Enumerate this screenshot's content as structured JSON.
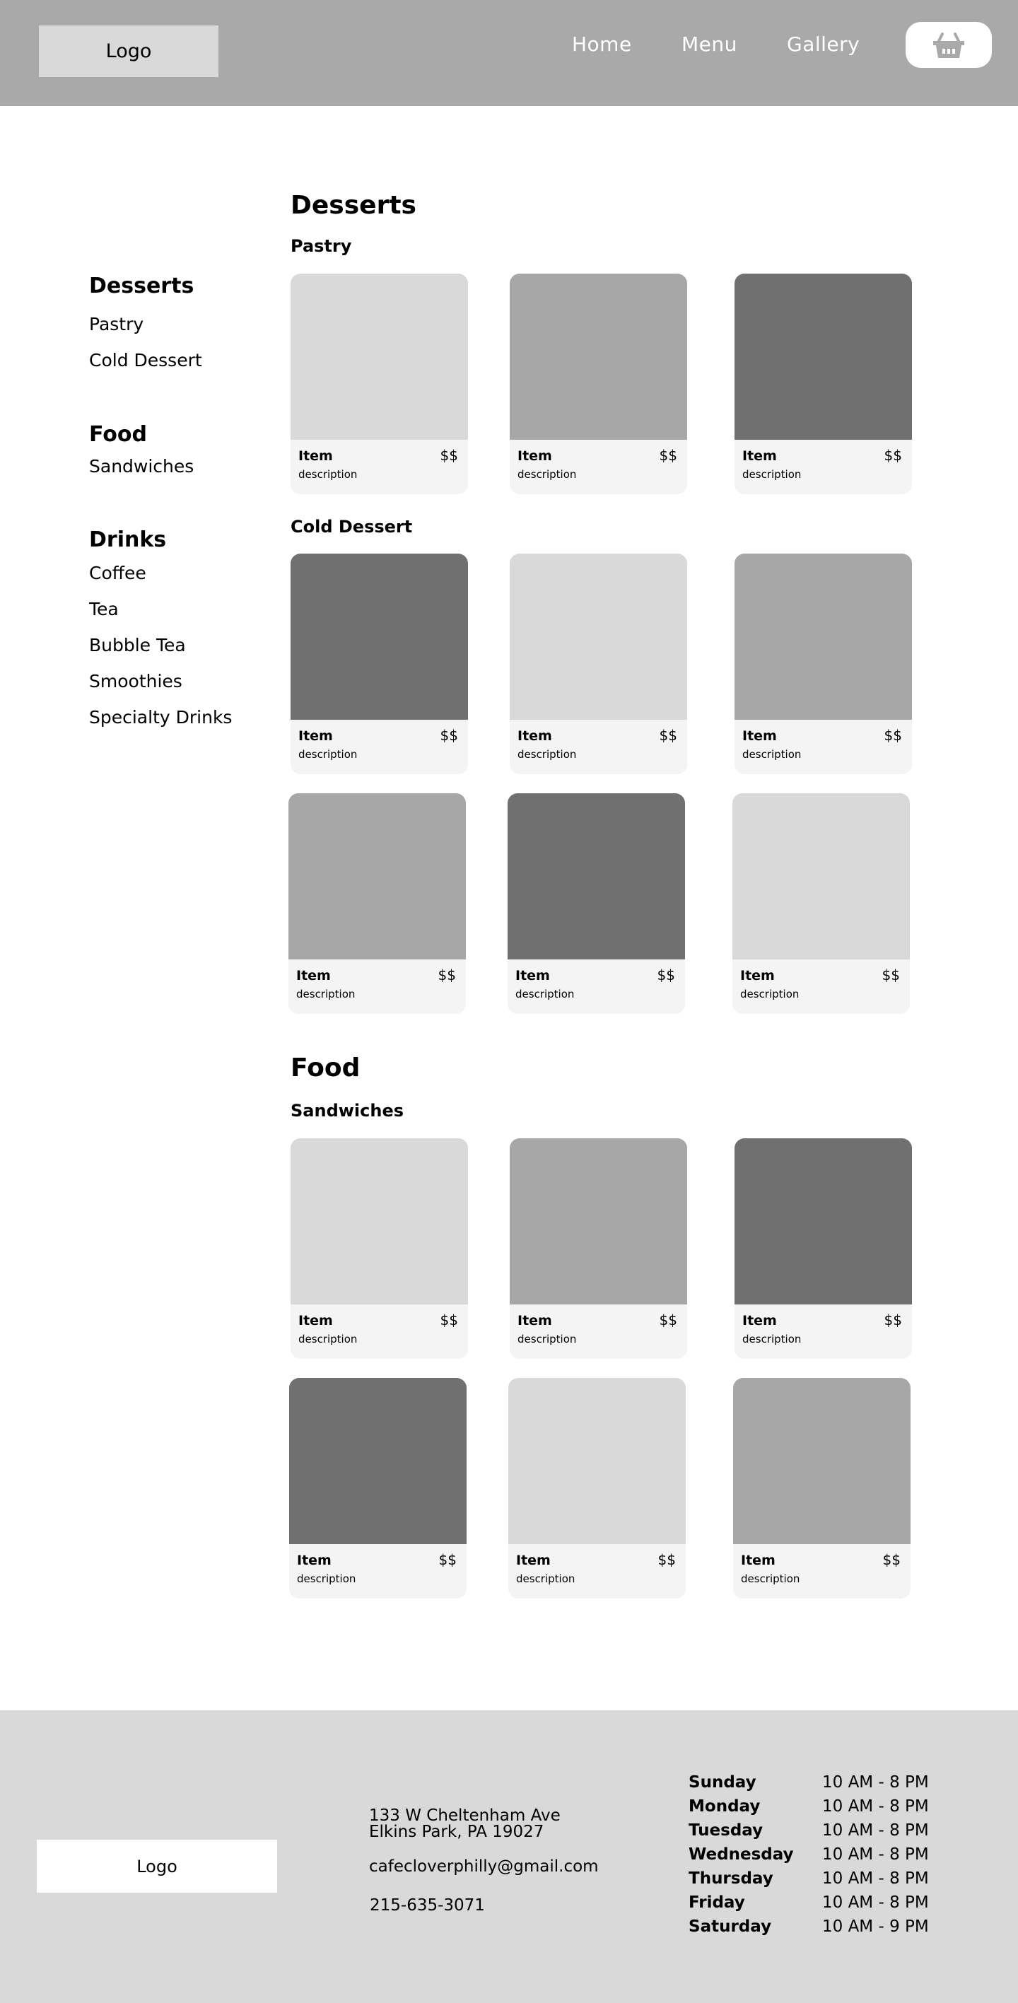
{
  "header": {
    "logo": "Logo",
    "nav": [
      "Home",
      "Menu",
      "Gallery"
    ],
    "cart_icon": "basket-icon"
  },
  "sidebar": {
    "groups": [
      {
        "heading": "Desserts",
        "items": [
          "Pastry",
          "Cold Dessert"
        ]
      },
      {
        "heading": "Food",
        "items": [
          "Sandwiches"
        ]
      },
      {
        "heading": "Drinks",
        "items": [
          "Coffee",
          "Tea",
          "Bubble Tea",
          "Smoothies",
          "Specialty Drinks"
        ]
      }
    ]
  },
  "colors": {
    "header_bg": "#a9a9a9",
    "footer_bg": "#d9d9d9",
    "card_bg": "#f4f4f4",
    "placeholder_light": "#d9d9d9",
    "placeholder_mid": "#a7a7a7",
    "placeholder_dark": "#707070"
  },
  "main": {
    "desserts": {
      "title": "Desserts",
      "pastry": {
        "title": "Pastry",
        "cards": [
          {
            "name": "Item",
            "price": "$$",
            "description": "description",
            "shade": "light"
          },
          {
            "name": "Item",
            "price": "$$",
            "description": "description",
            "shade": "mid"
          },
          {
            "name": "Item",
            "price": "$$",
            "description": "description",
            "shade": "dark"
          }
        ]
      },
      "cold_dessert": {
        "title": "Cold Dessert",
        "cards": [
          {
            "name": "Item",
            "price": "$$",
            "description": "description",
            "shade": "dark"
          },
          {
            "name": "Item",
            "price": "$$",
            "description": "description",
            "shade": "light"
          },
          {
            "name": "Item",
            "price": "$$",
            "description": "description",
            "shade": "mid"
          },
          {
            "name": "Item",
            "price": "$$",
            "description": "description",
            "shade": "mid"
          },
          {
            "name": "Item",
            "price": "$$",
            "description": "description",
            "shade": "dark"
          },
          {
            "name": "Item",
            "price": "$$",
            "description": "description",
            "shade": "light"
          }
        ]
      }
    },
    "food": {
      "title": "Food",
      "sandwiches": {
        "title": "Sandwiches",
        "cards": [
          {
            "name": "Item",
            "price": "$$",
            "description": "description",
            "shade": "light"
          },
          {
            "name": "Item",
            "price": "$$",
            "description": "description",
            "shade": "mid"
          },
          {
            "name": "Item",
            "price": "$$",
            "description": "description",
            "shade": "dark"
          },
          {
            "name": "Item",
            "price": "$$",
            "description": "description",
            "shade": "dark"
          },
          {
            "name": "Item",
            "price": "$$",
            "description": "description",
            "shade": "light"
          },
          {
            "name": "Item",
            "price": "$$",
            "description": "description",
            "shade": "mid"
          }
        ]
      }
    }
  },
  "footer": {
    "logo": "Logo",
    "address_line1": "133 W Cheltenham Ave",
    "address_line2": "Elkins Park, PA 19027",
    "email": "cafecloverphilly@gmail.com",
    "phone": "215-635-3071",
    "hours": [
      {
        "day": "Sunday",
        "time": "10 AM - 8 PM"
      },
      {
        "day": "Monday",
        "time": "10 AM - 8 PM"
      },
      {
        "day": "Tuesday",
        "time": "10 AM - 8 PM"
      },
      {
        "day": "Wednesday",
        "time": "10 AM - 8 PM"
      },
      {
        "day": "Thursday",
        "time": "10 AM - 8 PM"
      },
      {
        "day": "Friday",
        "time": "10 AM - 8 PM"
      },
      {
        "day": "Saturday",
        "time": "10 AM - 9 PM"
      }
    ]
  }
}
